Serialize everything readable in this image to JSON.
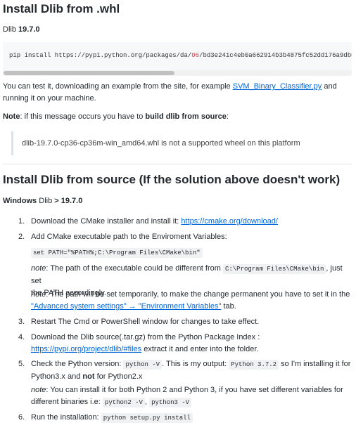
{
  "section1": {
    "title": "Install Dlib from .whl",
    "version_label": "Dlib",
    "version": "19.7.0",
    "code": {
      "prefix": "pip install https://pypi.python.org/packages/da/",
      "highlight": "06",
      "suffix": "/bd3e241c4eb0a662914b3b4875fc52dd176a9db0"
    },
    "test_text": "You can test it, downloading an example from the site, for example",
    "test_link": "SVM_Binary_Classifier.py",
    "test_and": "and",
    "test_text2": "running it on your machine.",
    "note_label": "Note",
    "note_text": ": if this message occurs you have to",
    "note_bold": "build dlib from source",
    "note_colon": ":",
    "error_text": "dlib-19.7.0-cp36-cp36m-win_amd64.whl is not a supported wheel on this platform"
  },
  "section2": {
    "title": "Install Dlib from source (If the solution above doesn't work)",
    "windows_label": "Windows",
    "windows_dlib": "Dlib",
    "windows_gt": "> 19.7.0",
    "steps": [
      {
        "num": "1.",
        "text": "Download the CMake installer and install it:",
        "link": "https://cmake.org/download/"
      },
      {
        "num": "2.",
        "text": "Add CMake executable path to the Enviroment Variables:",
        "code": "set PATH=\"%PATH%;C:\\Program Files\\CMake\\bin\"",
        "note1_label": "note",
        "note1_text": ": The path of the executable could be different from",
        "note1_code": "C:\\Program Files\\CMake\\bin",
        "note1_tail": ", just set",
        "note1_line2": "the PATH accordingly.",
        "note2_label": "note",
        "note2_text": ": The path will be set temporarily, to make the change permanent you have to set it in the",
        "note2_link": "\"Advanced system settings\" → \"Environment Variables\"",
        "note2_tail": "tab."
      },
      {
        "num": "3.",
        "text": "Restart The Cmd or PowerShell window for changes to take effect."
      },
      {
        "num": "4.",
        "text": "Download the Dlib source(.tar.gz) from the Python Package Index :",
        "link": "https://pypi.org/project/dlib/#files",
        "tail": "extract it and enter into the folder."
      },
      {
        "num": "5.",
        "text": "Check the Python version:",
        "code1": "python -V",
        "mid": ". This is my output:",
        "code2": "Python 3.7.2",
        "tail": "so I'm installing it for",
        "line2_a": "Python3.x and",
        "line2_bold": "not",
        "line2_b": "for Python2.x",
        "note_label": "note",
        "note_text": ": You can install it for both Python 2 and Python 3, if you have set different variables for",
        "note_line2": "different binaries i.e:",
        "note_code1": "python2 -V",
        "note_sep": ",",
        "note_code2": "python3 -V"
      },
      {
        "num": "6.",
        "text": "Run the installation:",
        "code": "python setup.py install"
      }
    ]
  }
}
